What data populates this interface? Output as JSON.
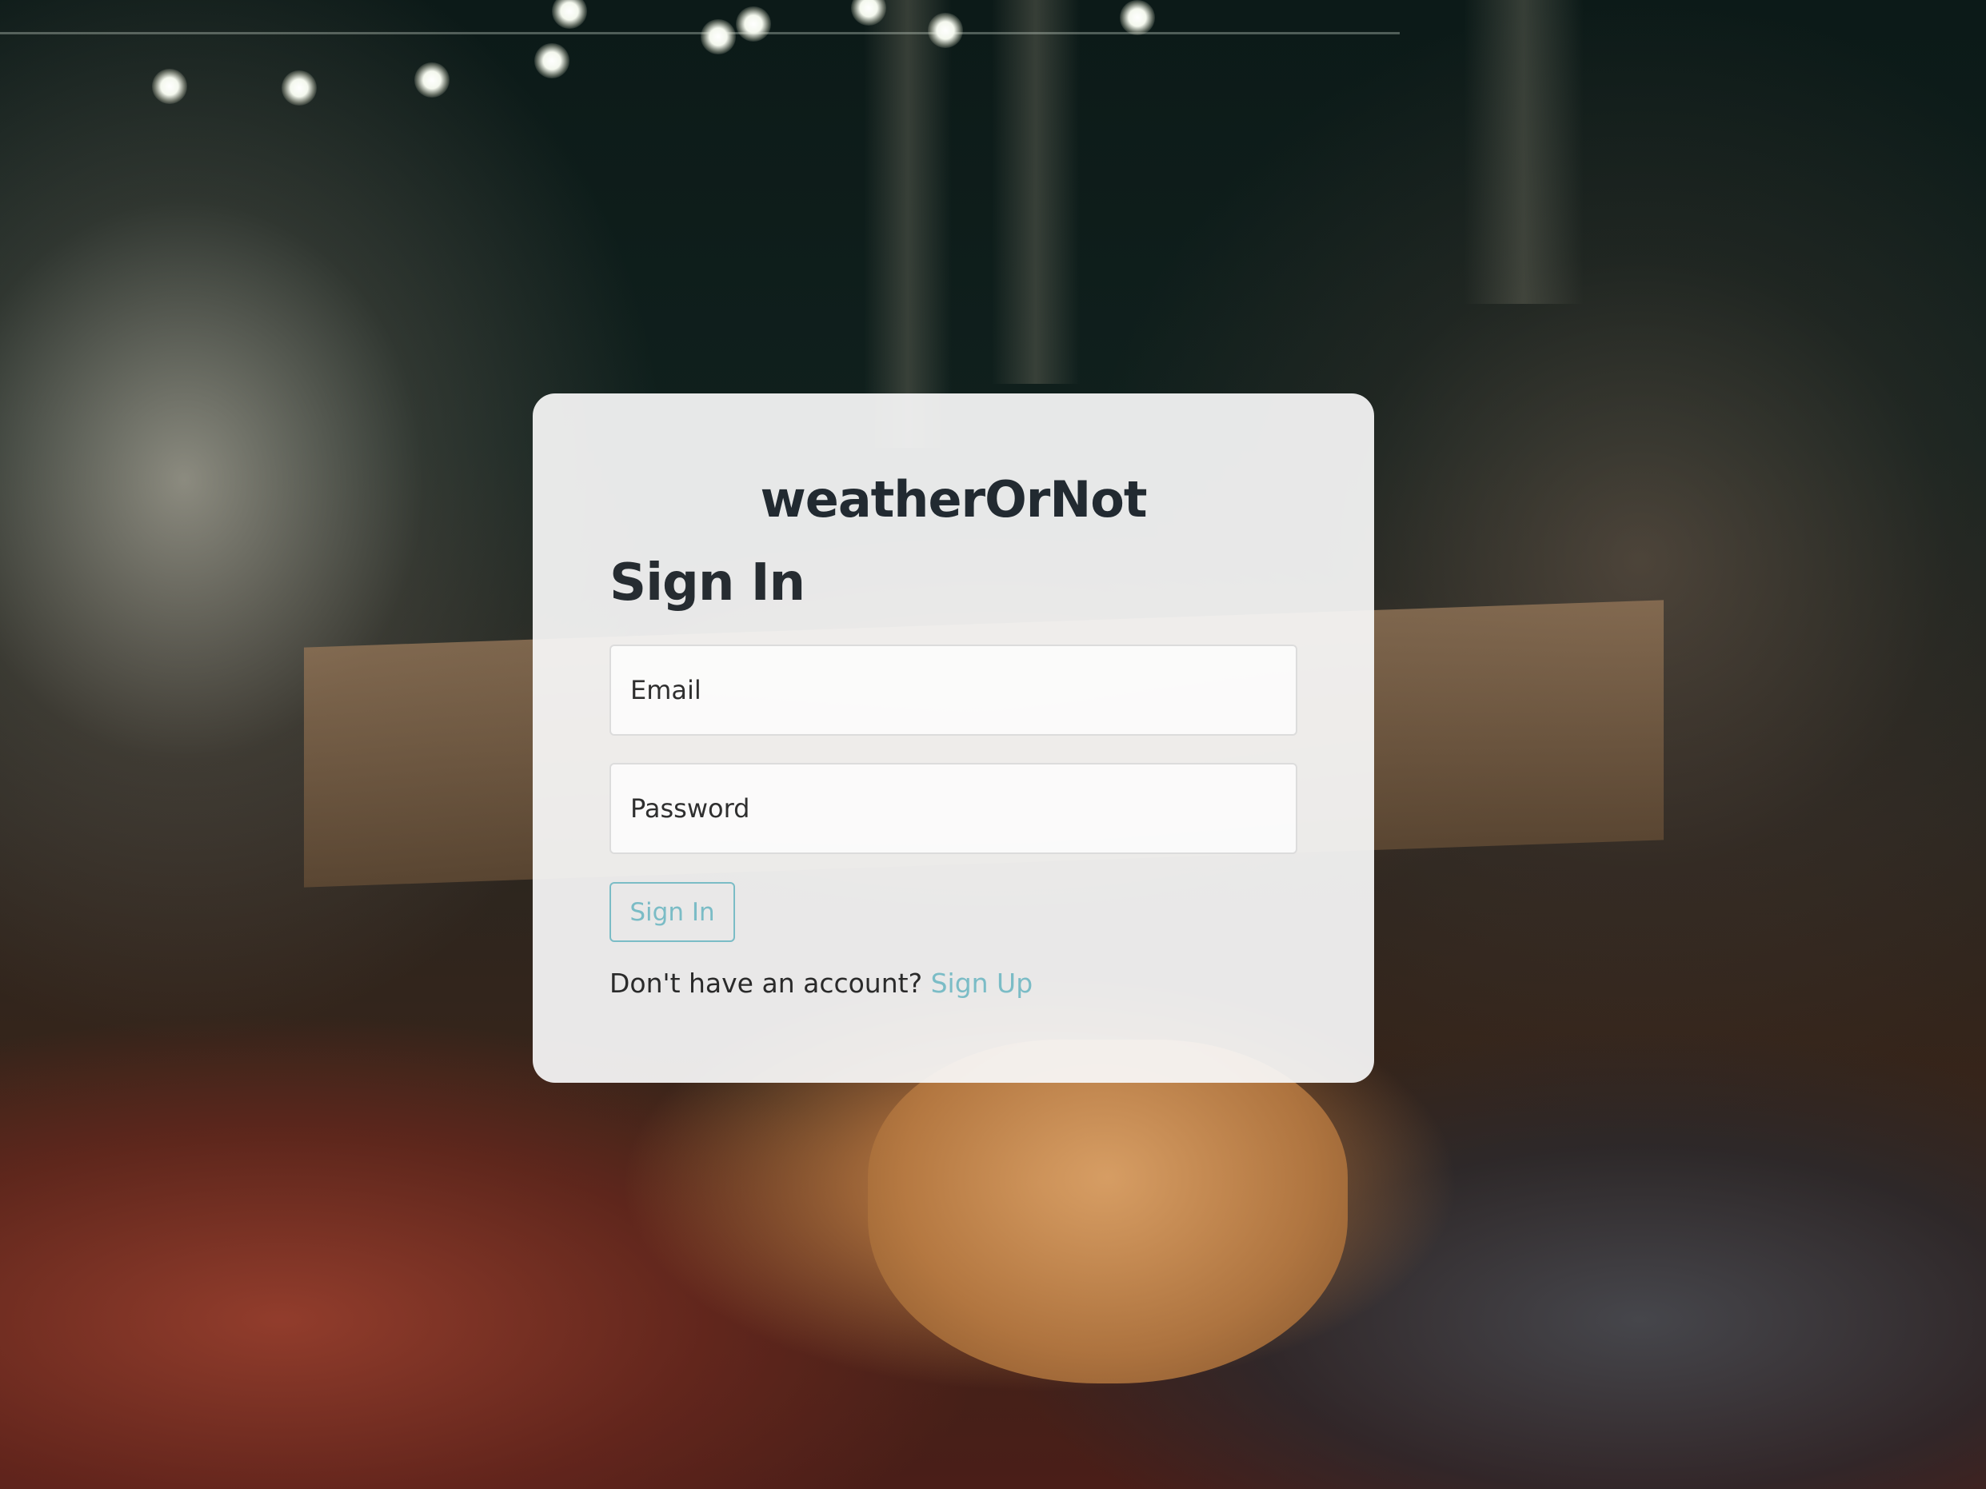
{
  "page": {
    "background_description": "night-time outdoor dinner party photo",
    "accent_color": "#7bbcc6"
  },
  "card": {
    "brand": "weatherOrNot",
    "heading": "Sign In",
    "email_placeholder": "Email",
    "password_placeholder": "Password",
    "submit_label": "Sign In",
    "signup_prompt": "Don't have an account?",
    "signup_link": "Sign Up"
  }
}
